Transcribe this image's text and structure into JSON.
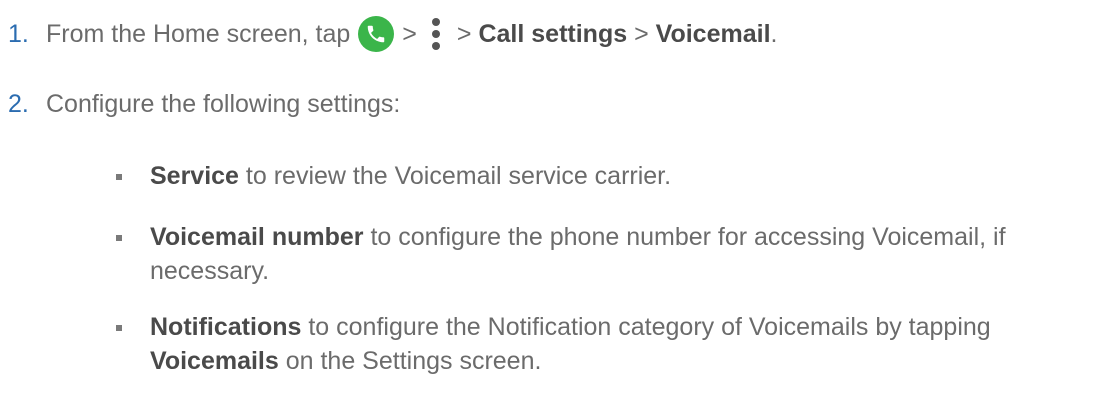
{
  "steps": [
    {
      "number": "1.",
      "pre": "From the Home screen, tap",
      "sep1": ">",
      "sep2": ">",
      "bold1": "Call settings",
      "sep3": ">",
      "bold2": "Voicemail",
      "end": ".",
      "icons": [
        "phone-icon",
        "more-vertical-icon"
      ]
    },
    {
      "number": "2.",
      "text": "Configure the following settings:"
    }
  ],
  "bullets": [
    {
      "bold": "Service",
      "text": " to review the Voicemail service carrier."
    },
    {
      "bold": "Voicemail number",
      "text": " to configure the phone number for accessing Voicemail, if",
      "text2": "necessary."
    },
    {
      "bold": "Notifications",
      "text": " to configure the Notification category of Voicemails by tapping",
      "bold2": "Voicemails",
      "text2": " on the Settings screen."
    }
  ],
  "colors": {
    "number": "#2b6cb0",
    "text": "#6b6b6b",
    "phone_icon_bg": "#3bb54a"
  }
}
